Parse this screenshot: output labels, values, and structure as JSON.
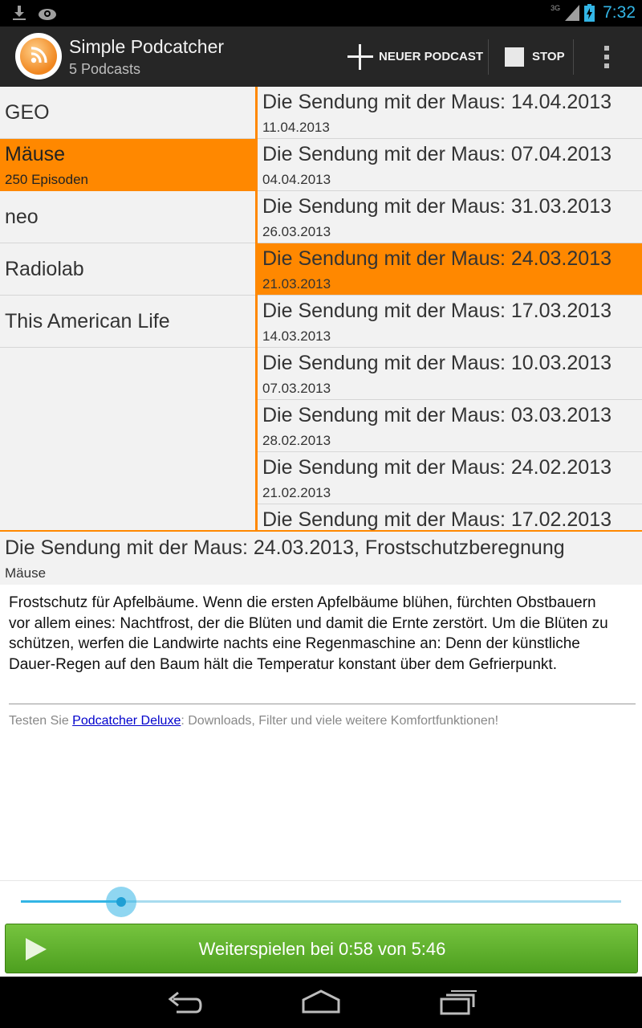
{
  "status_bar": {
    "network": "3G",
    "time": "7:32"
  },
  "action_bar": {
    "title": "Simple Podcatcher",
    "subtitle": "5 Podcasts",
    "new_podcast_label": "NEUER PODCAST",
    "stop_label": "STOP"
  },
  "podcasts": [
    {
      "name": "GEO",
      "count": ""
    },
    {
      "name": "Mäuse",
      "count": "250 Episoden"
    },
    {
      "name": "neo",
      "count": ""
    },
    {
      "name": "Radiolab",
      "count": ""
    },
    {
      "name": "This American Life",
      "count": ""
    }
  ],
  "episodes": [
    {
      "title": "Die Sendung mit der Maus: 14.04.2013",
      "date": "11.04.2013"
    },
    {
      "title": "Die Sendung mit der Maus: 07.04.2013",
      "date": "04.04.2013"
    },
    {
      "title": "Die Sendung mit der Maus: 31.03.2013",
      "date": "26.03.2013"
    },
    {
      "title": "Die Sendung mit der Maus: 24.03.2013",
      "date": "21.03.2013"
    },
    {
      "title": "Die Sendung mit der Maus: 17.03.2013",
      "date": "14.03.2013"
    },
    {
      "title": "Die Sendung mit der Maus: 10.03.2013",
      "date": "07.03.2013"
    },
    {
      "title": "Die Sendung mit der Maus: 03.03.2013",
      "date": "28.02.2013"
    },
    {
      "title": "Die Sendung mit der Maus: 24.02.2013",
      "date": "21.02.2013"
    },
    {
      "title": "Die Sendung mit der Maus: 17.02.2013",
      "date": ""
    }
  ],
  "detail": {
    "title": "Die Sendung mit der Maus: 24.03.2013, Frostschutzberegnung",
    "podcast": "Mäuse",
    "description": "Frostschutz für Apfelbäume. Wenn die ersten Apfelbäume blühen, fürchten Obstbauern vor allem eines: Nachtfrost, der die Blüten und damit die Ernte zerstört. Um die Blüten zu schützen, werfen die Landwirte nachts eine Regenmaschine an: Denn der künstliche Dauer-Regen auf den Baum hält die Temperatur konstant über dem Gefrierpunkt.",
    "promo_prefix": "Testen Sie ",
    "promo_link": "Podcatcher Deluxe",
    "promo_suffix": ": Downloads, Filter und viele weitere Komfortfunktionen!"
  },
  "player": {
    "progress": 0.167,
    "button_label": "Weiterspielen bei 0:58 von 5:46"
  },
  "colors": {
    "accent": "#ff8800",
    "holo_blue": "#33b5e5",
    "play_green": "#5fb22e"
  },
  "icons": [
    "download-icon",
    "sync-icon",
    "signal-icon",
    "battery-icon",
    "podcast-logo-icon",
    "plus-icon",
    "stop-icon",
    "overflow-menu-icon",
    "play-icon",
    "back-icon",
    "home-icon",
    "recents-icon"
  ]
}
